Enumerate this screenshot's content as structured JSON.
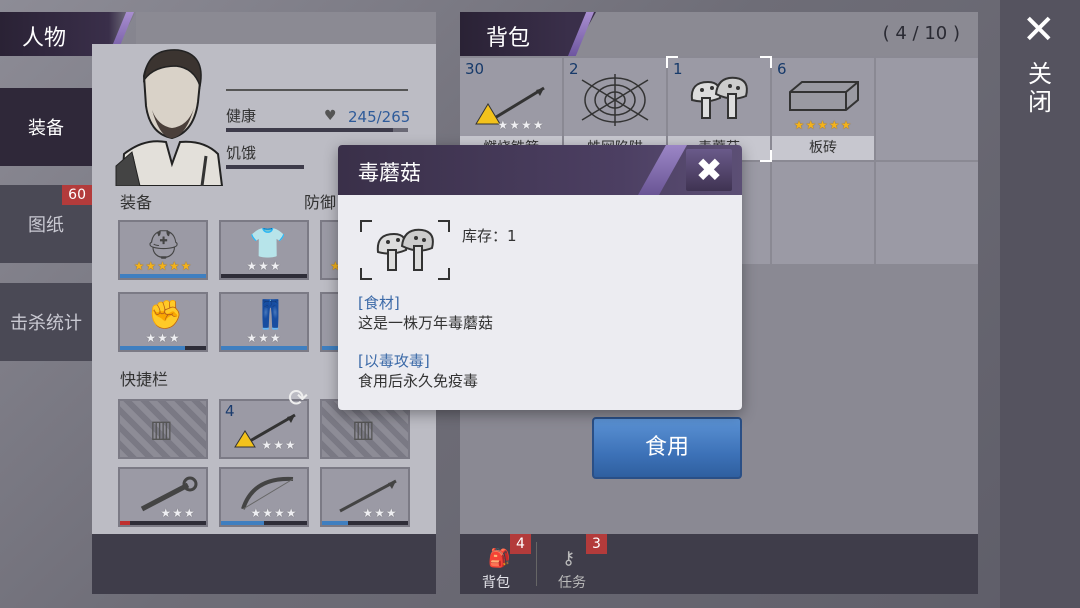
{
  "character_panel": {
    "title": "人物",
    "side_tabs": [
      {
        "label": "装备",
        "active": true
      },
      {
        "label": "图纸",
        "badge": "60"
      },
      {
        "label": "击杀统计"
      }
    ],
    "stats": {
      "health_label": "健康",
      "health_value": "245/265",
      "hunger_label": "饥饿"
    },
    "equipment_label": "装备",
    "defense_label": "防御",
    "quickbar_label": "快捷栏",
    "equipment_slots": [
      {
        "icon": "gas-mask-icon",
        "stars_gold": 5,
        "stars_total": 5
      },
      {
        "icon": "hoodie-icon",
        "stars_gold": 0,
        "stars_total": 3
      },
      {
        "icon": "gloves-icon",
        "stars_gold": 0,
        "stars_total": 3
      },
      {
        "icon": "pants-icon",
        "stars_gold": 0,
        "stars_total": 3
      }
    ],
    "quickbar_slots": [
      {
        "icon": "empty-fence-icon",
        "empty": true
      },
      {
        "icon": "burning-spear-icon",
        "count": "4",
        "stars_gold": 0,
        "stars_total": 3
      },
      {
        "icon": "empty-fence-icon",
        "empty": true
      },
      {
        "icon": "wrench-icon",
        "stars_gold": 0,
        "stars_total": 3
      },
      {
        "icon": "bow-icon",
        "stars_gold": 0,
        "stars_total": 4
      },
      {
        "icon": "spear-icon",
        "stars_gold": 0,
        "stars_total": 3
      }
    ]
  },
  "bag_panel": {
    "title": "背包",
    "capacity": "( 4 / 10 )",
    "items": [
      {
        "count": "30",
        "name": "燃烧铁箭",
        "icon": "burning-spear-icon",
        "stars_gold": 0,
        "stars_total": 4
      },
      {
        "count": "2",
        "name": "蛛网陷阱",
        "icon": "spider-web-icon",
        "stars_gold": 0,
        "stars_total": 0
      },
      {
        "count": "1",
        "name": "毒蘑菇",
        "icon": "mushroom-icon",
        "stars_gold": 0,
        "stars_total": 0,
        "selected": true
      },
      {
        "count": "6",
        "name": "板砖",
        "icon": "brick-icon",
        "stars_gold": 5,
        "stars_total": 5
      }
    ],
    "footer_tabs": [
      {
        "label": "背包",
        "badge": "4",
        "icon": "backpack-icon"
      },
      {
        "label": "任务",
        "badge": "3",
        "icon": "key-icon"
      }
    ]
  },
  "close": {
    "label": "关闭"
  },
  "popup": {
    "title": "毒蘑菇",
    "stock": "库存：1",
    "tag1": "[食材]",
    "desc1": "这是一株万年毒蘑菇",
    "tag2": "[以毒攻毒]",
    "desc2": "食用后永久免疫毒",
    "icon": "mushroom-icon"
  },
  "use_button": {
    "label": "食用"
  },
  "colors": {
    "accent_purple": "#3a2f4a",
    "button_blue": "#3d72b8",
    "star_gold": "#f3b21b",
    "badge_red": "#b33b3b"
  }
}
